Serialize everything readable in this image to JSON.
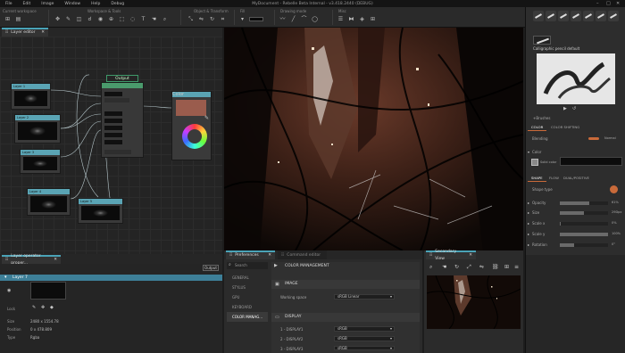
{
  "menu": {
    "items": [
      "File",
      "Edit",
      "Image",
      "Window",
      "Help",
      "Debug"
    ],
    "title": "MyDocument - Rebelle Beta Internal - v3.418.2440 (DEBUG)"
  },
  "toolbar": {
    "groups": [
      "Current workspace",
      "Workspace & Tools",
      "Object & Transform",
      "Fill",
      "Drawing mode",
      "Misc"
    ]
  },
  "layer_editor": {
    "tab_label": "Layer editor",
    "output_label": "Output",
    "nodes": [
      "Layer 1",
      "Layer 2",
      "Layer 3",
      "Layer 4",
      "Layer 5",
      "Color"
    ]
  },
  "layer_operator": {
    "tab_label": "Layer operator proper...",
    "output_button": "Output",
    "selected_layer": "Layer 7",
    "lock_label": "Lock",
    "props": [
      {
        "label": "Size",
        "value": "2480 x 1554.78"
      },
      {
        "label": "Position",
        "value": "0 x 478.809"
      },
      {
        "label": "Type",
        "value": "Rgba"
      }
    ]
  },
  "preferences": {
    "tab_label": "Preferences",
    "tab2_label": "Command editor",
    "search_placeholder": "Search",
    "section_title": "COLOR MANAGEMENT",
    "sidebar": [
      "GENERAL",
      "STYLUS",
      "GPU",
      "KEYBOARD",
      "COLOR MANAG..."
    ],
    "image_section": "IMAGE",
    "working_space_label": "Working space",
    "working_space_value": "sRGB Linear",
    "display_section": "DISPLAY",
    "displays": [
      {
        "label": "1 - DISPLAY1",
        "value": "sRGB"
      },
      {
        "label": "2 - DISPLAY2",
        "value": "sRGB"
      },
      {
        "label": "3 - DISPLAY3",
        "value": "sRGB"
      }
    ]
  },
  "secondary_view": {
    "tab_label": "Secondary View"
  },
  "right_panel": {
    "brush_name": "Calligraphic pencil default",
    "brush_preset_label": "+Brushes",
    "tabs": [
      "COLOR",
      "COLOR SHIFTING"
    ],
    "blending_label": "Blending",
    "blending_value": "Normal",
    "color_label": "Color",
    "solid_color": "Solid color",
    "tabs2": [
      "SHAPE",
      "FLOW",
      "DUAL/POSITIVE"
    ],
    "shape_type_label": "Shape type",
    "params": [
      {
        "label": "Opacity",
        "value": "61%",
        "level": 0.61
      },
      {
        "label": "Size",
        "value": "29Dpx",
        "level": 0.5
      },
      {
        "label": "Scale x",
        "value": "0%",
        "level": 0.02
      },
      {
        "label": "Scale y",
        "value": "100%",
        "level": 1.0
      },
      {
        "label": "Rotation",
        "value": "0°",
        "level": 0.3
      }
    ]
  },
  "colors": {
    "accent": "#4aa3b7",
    "selection": "#3d7f98",
    "node_header": "#5aa4b4",
    "output_green": "#4a9a6c",
    "orange": "#c96a3a"
  }
}
